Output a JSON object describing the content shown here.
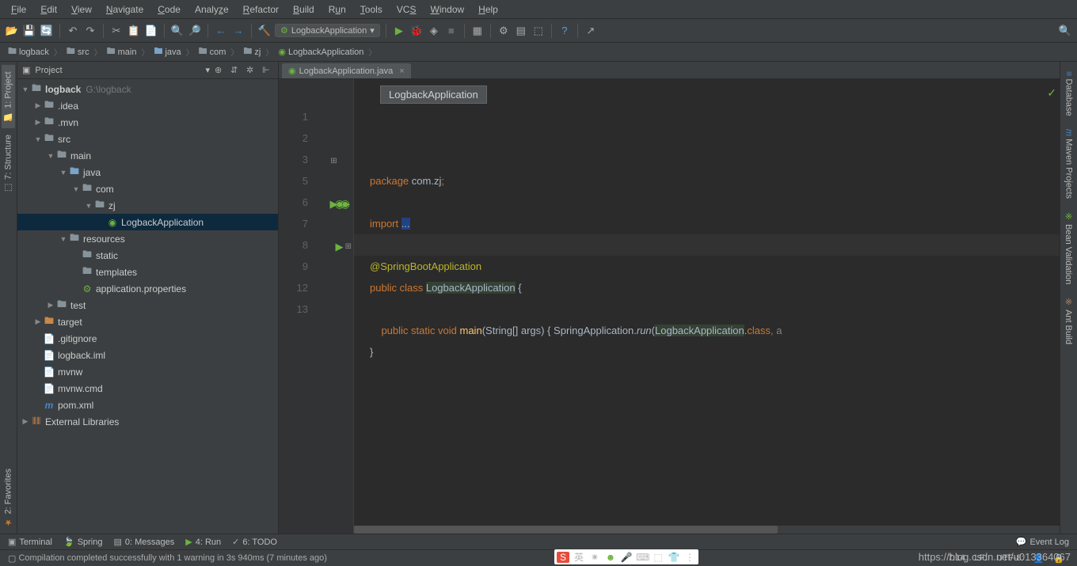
{
  "menu": [
    "File",
    "Edit",
    "View",
    "Navigate",
    "Code",
    "Analyze",
    "Refactor",
    "Build",
    "Run",
    "Tools",
    "VCS",
    "Window",
    "Help"
  ],
  "runConfig": {
    "name": "LogbackApplication"
  },
  "breadcrumb": [
    {
      "icon": "folder",
      "label": "logback"
    },
    {
      "icon": "folder",
      "label": "src"
    },
    {
      "icon": "folder",
      "label": "main"
    },
    {
      "icon": "java",
      "label": "java"
    },
    {
      "icon": "folder",
      "label": "com"
    },
    {
      "icon": "folder",
      "label": "zj"
    },
    {
      "icon": "class",
      "label": "LogbackApplication"
    }
  ],
  "project": {
    "title": "Project",
    "root": {
      "label": "logback",
      "meta": "G:\\logback"
    },
    "tree": [
      {
        "indent": 0,
        "arrow": "▼",
        "icon": "📁",
        "label": "logback",
        "bold": true,
        "meta": "G:\\logback"
      },
      {
        "indent": 1,
        "arrow": "▶",
        "icon": "📁",
        "label": ".idea"
      },
      {
        "indent": 1,
        "arrow": "▶",
        "icon": "📁",
        "label": ".mvn"
      },
      {
        "indent": 1,
        "arrow": "▼",
        "icon": "📁",
        "label": "src"
      },
      {
        "indent": 2,
        "arrow": "▼",
        "icon": "📁",
        "label": "main"
      },
      {
        "indent": 3,
        "arrow": "▼",
        "icon": "📁",
        "label": "java",
        "java": true
      },
      {
        "indent": 4,
        "arrow": "▼",
        "icon": "📁",
        "label": "com"
      },
      {
        "indent": 5,
        "arrow": "▼",
        "icon": "📁",
        "label": "zj"
      },
      {
        "indent": 6,
        "arrow": "",
        "icon": "◉",
        "label": "LogbackApplication",
        "selected": true,
        "class": true
      },
      {
        "indent": 3,
        "arrow": "▼",
        "icon": "📁",
        "label": "resources"
      },
      {
        "indent": 4,
        "arrow": "",
        "icon": "📁",
        "label": "static"
      },
      {
        "indent": 4,
        "arrow": "",
        "icon": "📁",
        "label": "templates"
      },
      {
        "indent": 4,
        "arrow": "",
        "icon": "⚙",
        "label": "application.properties",
        "spring": true
      },
      {
        "indent": 2,
        "arrow": "▶",
        "icon": "📁",
        "label": "test"
      },
      {
        "indent": 1,
        "arrow": "▶",
        "icon": "📁",
        "label": "target",
        "target": true
      },
      {
        "indent": 1,
        "arrow": "",
        "icon": "📄",
        "label": ".gitignore"
      },
      {
        "indent": 1,
        "arrow": "",
        "icon": "📄",
        "label": "logback.iml"
      },
      {
        "indent": 1,
        "arrow": "",
        "icon": "📄",
        "label": "mvnw"
      },
      {
        "indent": 1,
        "arrow": "",
        "icon": "📄",
        "label": "mvnw.cmd"
      },
      {
        "indent": 1,
        "arrow": "",
        "icon": "m",
        "label": "pom.xml",
        "maven": true
      },
      {
        "indent": 0,
        "arrow": "▶",
        "icon": "📚",
        "label": "External Libraries"
      }
    ]
  },
  "tabs": [
    {
      "label": "LogbackApplication.java"
    }
  ],
  "editor": {
    "breadcrumb": "LogbackApplication",
    "lines": [
      1,
      2,
      3,
      5,
      6,
      7,
      8,
      9,
      12,
      13
    ],
    "currentLine": 7
  },
  "code": {
    "l1_pkg": "package",
    "l1_val": "com.zj",
    "l1_semi": ";",
    "l3_imp": "import",
    "l3_dots": "...",
    "l6_ann": "@SpringBootApplication",
    "l7_pub": "public",
    "l7_cls": "class",
    "l7_name": "LogbackApplication",
    "l7_br": " {",
    "l9_pub": "public",
    "l9_stat": "static",
    "l9_void": "void",
    "l9_main": "main",
    "l9_p1": "(",
    "l9_str": "String",
    "l9_arr": "[] args)",
    "l9_br": " { ",
    "l9_app": "SpringApplication",
    "l9_dot": ".",
    "l9_run": "run",
    "l9_p2": "(",
    "l9_cls2": "LogbackApplication",
    "l9_dot2": ".",
    "l9_class": "class",
    "l9_comma": ", a",
    "l12": "}"
  },
  "leftTabs": [
    "1: Project",
    "7: Structure"
  ],
  "leftBottom": "2: Favorites",
  "rightTabs": [
    "Database",
    "Maven Projects",
    "Bean Validation",
    "Ant Build"
  ],
  "bottomTabs": [
    {
      "icon": "▣",
      "label": "Terminal"
    },
    {
      "icon": "🍃",
      "label": "Spring",
      "color": "#6db33f"
    },
    {
      "icon": "▤",
      "label": "0: Messages"
    },
    {
      "icon": "▶",
      "label": "4: Run",
      "color": "#6db33f"
    },
    {
      "icon": "✓",
      "label": "6: TODO"
    }
  ],
  "eventLog": "Event Log",
  "status": {
    "msg": "Compilation completed successfully with 1 warning in 3s 940ms (7 minutes ago)",
    "pos": "7:14",
    "lf": "LF:",
    "enc": "UTF-8:"
  },
  "watermark": "https://blog.csdn.net/u013364067"
}
